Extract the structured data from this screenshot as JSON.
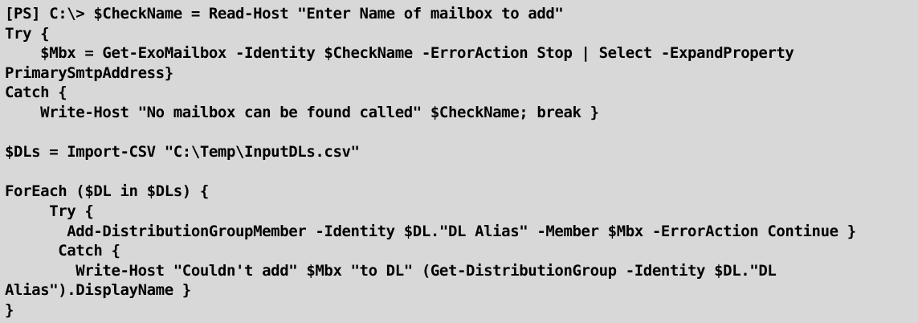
{
  "code": {
    "lines": [
      "[PS] C:\\> $CheckName = Read-Host \"Enter Name of mailbox to add\"",
      "Try {",
      "    $Mbx = Get-ExoMailbox -Identity $CheckName -ErrorAction Stop | Select -ExpandProperty",
      "PrimarySmtpAddress}",
      "Catch {",
      "    Write-Host \"No mailbox can be found called\" $CheckName; break }",
      "",
      "$DLs = Import-CSV \"C:\\Temp\\InputDLs.csv\"",
      "",
      "ForEach ($DL in $DLs) {",
      "     Try {",
      "       Add-DistributionGroupMember -Identity $DL.\"DL Alias\" -Member $Mbx -ErrorAction Continue }",
      "      Catch {",
      "        Write-Host \"Couldn't add\" $Mbx \"to DL\" (Get-DistributionGroup -Identity $DL.\"DL",
      "Alias\").DisplayName }",
      "}"
    ]
  }
}
